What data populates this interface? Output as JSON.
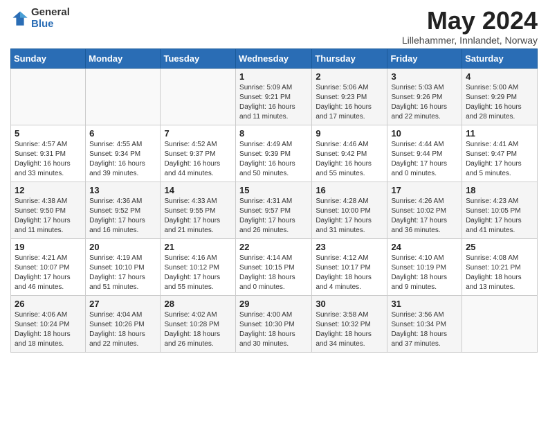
{
  "header": {
    "logo_general": "General",
    "logo_blue": "Blue",
    "month_title": "May 2024",
    "subtitle": "Lillehammer, Innlandet, Norway"
  },
  "weekdays": [
    "Sunday",
    "Monday",
    "Tuesday",
    "Wednesday",
    "Thursday",
    "Friday",
    "Saturday"
  ],
  "weeks": [
    [
      {
        "day": "",
        "info": ""
      },
      {
        "day": "",
        "info": ""
      },
      {
        "day": "",
        "info": ""
      },
      {
        "day": "1",
        "info": "Sunrise: 5:09 AM\nSunset: 9:21 PM\nDaylight: 16 hours\nand 11 minutes."
      },
      {
        "day": "2",
        "info": "Sunrise: 5:06 AM\nSunset: 9:23 PM\nDaylight: 16 hours\nand 17 minutes."
      },
      {
        "day": "3",
        "info": "Sunrise: 5:03 AM\nSunset: 9:26 PM\nDaylight: 16 hours\nand 22 minutes."
      },
      {
        "day": "4",
        "info": "Sunrise: 5:00 AM\nSunset: 9:29 PM\nDaylight: 16 hours\nand 28 minutes."
      }
    ],
    [
      {
        "day": "5",
        "info": "Sunrise: 4:57 AM\nSunset: 9:31 PM\nDaylight: 16 hours\nand 33 minutes."
      },
      {
        "day": "6",
        "info": "Sunrise: 4:55 AM\nSunset: 9:34 PM\nDaylight: 16 hours\nand 39 minutes."
      },
      {
        "day": "7",
        "info": "Sunrise: 4:52 AM\nSunset: 9:37 PM\nDaylight: 16 hours\nand 44 minutes."
      },
      {
        "day": "8",
        "info": "Sunrise: 4:49 AM\nSunset: 9:39 PM\nDaylight: 16 hours\nand 50 minutes."
      },
      {
        "day": "9",
        "info": "Sunrise: 4:46 AM\nSunset: 9:42 PM\nDaylight: 16 hours\nand 55 minutes."
      },
      {
        "day": "10",
        "info": "Sunrise: 4:44 AM\nSunset: 9:44 PM\nDaylight: 17 hours\nand 0 minutes."
      },
      {
        "day": "11",
        "info": "Sunrise: 4:41 AM\nSunset: 9:47 PM\nDaylight: 17 hours\nand 5 minutes."
      }
    ],
    [
      {
        "day": "12",
        "info": "Sunrise: 4:38 AM\nSunset: 9:50 PM\nDaylight: 17 hours\nand 11 minutes."
      },
      {
        "day": "13",
        "info": "Sunrise: 4:36 AM\nSunset: 9:52 PM\nDaylight: 17 hours\nand 16 minutes."
      },
      {
        "day": "14",
        "info": "Sunrise: 4:33 AM\nSunset: 9:55 PM\nDaylight: 17 hours\nand 21 minutes."
      },
      {
        "day": "15",
        "info": "Sunrise: 4:31 AM\nSunset: 9:57 PM\nDaylight: 17 hours\nand 26 minutes."
      },
      {
        "day": "16",
        "info": "Sunrise: 4:28 AM\nSunset: 10:00 PM\nDaylight: 17 hours\nand 31 minutes."
      },
      {
        "day": "17",
        "info": "Sunrise: 4:26 AM\nSunset: 10:02 PM\nDaylight: 17 hours\nand 36 minutes."
      },
      {
        "day": "18",
        "info": "Sunrise: 4:23 AM\nSunset: 10:05 PM\nDaylight: 17 hours\nand 41 minutes."
      }
    ],
    [
      {
        "day": "19",
        "info": "Sunrise: 4:21 AM\nSunset: 10:07 PM\nDaylight: 17 hours\nand 46 minutes."
      },
      {
        "day": "20",
        "info": "Sunrise: 4:19 AM\nSunset: 10:10 PM\nDaylight: 17 hours\nand 51 minutes."
      },
      {
        "day": "21",
        "info": "Sunrise: 4:16 AM\nSunset: 10:12 PM\nDaylight: 17 hours\nand 55 minutes."
      },
      {
        "day": "22",
        "info": "Sunrise: 4:14 AM\nSunset: 10:15 PM\nDaylight: 18 hours\nand 0 minutes."
      },
      {
        "day": "23",
        "info": "Sunrise: 4:12 AM\nSunset: 10:17 PM\nDaylight: 18 hours\nand 4 minutes."
      },
      {
        "day": "24",
        "info": "Sunrise: 4:10 AM\nSunset: 10:19 PM\nDaylight: 18 hours\nand 9 minutes."
      },
      {
        "day": "25",
        "info": "Sunrise: 4:08 AM\nSunset: 10:21 PM\nDaylight: 18 hours\nand 13 minutes."
      }
    ],
    [
      {
        "day": "26",
        "info": "Sunrise: 4:06 AM\nSunset: 10:24 PM\nDaylight: 18 hours\nand 18 minutes."
      },
      {
        "day": "27",
        "info": "Sunrise: 4:04 AM\nSunset: 10:26 PM\nDaylight: 18 hours\nand 22 minutes."
      },
      {
        "day": "28",
        "info": "Sunrise: 4:02 AM\nSunset: 10:28 PM\nDaylight: 18 hours\nand 26 minutes."
      },
      {
        "day": "29",
        "info": "Sunrise: 4:00 AM\nSunset: 10:30 PM\nDaylight: 18 hours\nand 30 minutes."
      },
      {
        "day": "30",
        "info": "Sunrise: 3:58 AM\nSunset: 10:32 PM\nDaylight: 18 hours\nand 34 minutes."
      },
      {
        "day": "31",
        "info": "Sunrise: 3:56 AM\nSunset: 10:34 PM\nDaylight: 18 hours\nand 37 minutes."
      },
      {
        "day": "",
        "info": ""
      }
    ]
  ]
}
